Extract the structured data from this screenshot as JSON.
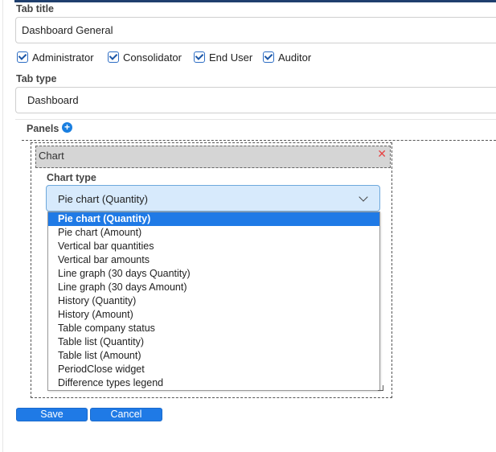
{
  "form": {
    "tab_title_label": "Tab title",
    "tab_title_value": "Dashboard General",
    "roles": [
      {
        "label": "Administrator",
        "checked": true
      },
      {
        "label": "Consolidator",
        "checked": true
      },
      {
        "label": "End User",
        "checked": true
      },
      {
        "label": "Auditor",
        "checked": true
      }
    ],
    "tab_type_label": "Tab type",
    "tab_type_value": "Dashboard",
    "panels_label": "Panels",
    "add_icon": "plus-circle-icon",
    "close_icon": "close-icon"
  },
  "panel": {
    "header": "Chart",
    "chart_type_label": "Chart type",
    "selected": "Pie chart (Quantity)",
    "options": [
      "Pie chart (Quantity)",
      "Pie chart (Amount)",
      "Vertical bar quantities",
      "Vertical bar amounts",
      "Line graph (30 days Quantity)",
      "Line graph (30 days Amount)",
      "History (Quantity)",
      "History (Amount)",
      "Table company status",
      "Table list (Quantity)",
      "Table list (Amount)",
      "PeriodClose widget",
      "Difference types legend"
    ]
  },
  "buttons": {
    "save": "Save",
    "cancel": "Cancel"
  },
  "colors": {
    "accent": "#1f7ae6",
    "select_bg": "#d7eafc",
    "close": "#e64545"
  }
}
